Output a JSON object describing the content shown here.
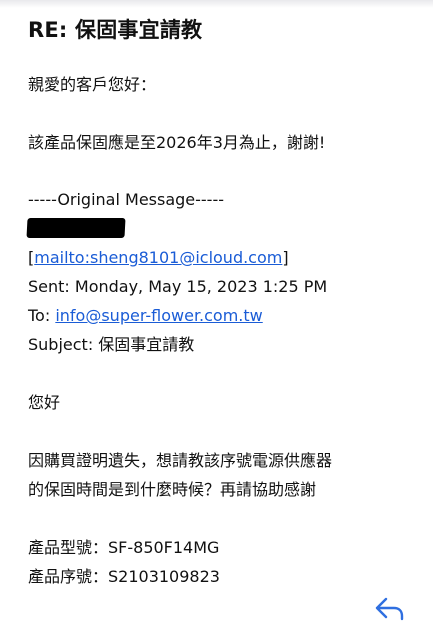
{
  "email": {
    "subject": "RE: 保固事宜請教",
    "greeting": "親愛的客戶您好：",
    "answer": "該產品保固應是至2026年3月為止，謝謝!",
    "divider": "-----Original Message-----",
    "mailto_open": "[",
    "mailto_link": "mailto:sheng8101@icloud.com",
    "mailto_close": "]",
    "sent": "Sent: Monday, May 15, 2023 1:25 PM",
    "to_label": "To: ",
    "to_link": "info@super-flower.com.tw",
    "original_subject": "Subject: 保固事宜請教",
    "original_greeting": "您好",
    "body_line1": "因購買證明遺失，想請教該序號電源供應器",
    "body_line2": "的保固時間是到什麼時候？再請協助感謝",
    "model": "產品型號：SF-850F14MG",
    "serial": "產品序號：S2103109823"
  },
  "icons": {
    "reply": "reply-arrow-icon"
  },
  "colors": {
    "link": "#1a5cd6",
    "text": "#111111",
    "icon": "#2f6fe0"
  }
}
